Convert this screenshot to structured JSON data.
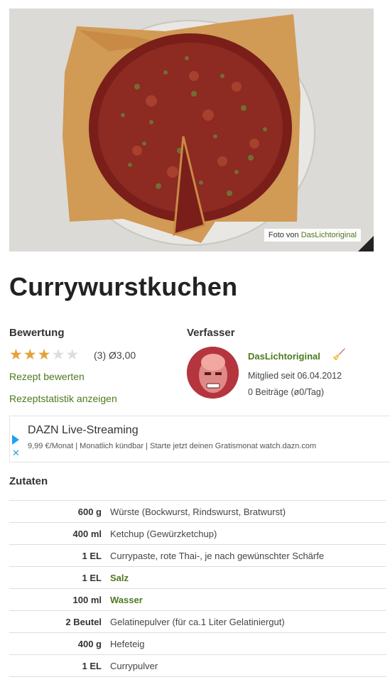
{
  "photo": {
    "credit_prefix": "Foto von",
    "credit_author": "DasLichtoriginal"
  },
  "recipe": {
    "title": "Currywurstkuchen"
  },
  "rating": {
    "heading": "Bewertung",
    "stars_filled": 3,
    "stars_total": 5,
    "summary": "(3)  Ø3,00",
    "rate_link": "Rezept bewerten",
    "stats_link": "Rezeptstatistik anzeigen"
  },
  "author": {
    "heading": "Verfasser",
    "name": "DasLichtoriginal",
    "member_since": "Mitglied seit 06.04.2012",
    "posts": "0 Beiträge (ø0/Tag)"
  },
  "ad": {
    "title": "DAZN Live-Streaming",
    "text": "9,99 €/Monat | Monatlich kündbar | Starte jetzt deinen Gratismonat watch.dazn.com"
  },
  "ingredients": {
    "heading": "Zutaten",
    "rows": [
      {
        "amount": "600 g",
        "name": "Würste (Bockwurst, Rindswurst, Bratwurst)",
        "linked": false
      },
      {
        "amount": "400 ml",
        "name": "Ketchup (Gewürzketchup)",
        "linked": false
      },
      {
        "amount": "1 EL",
        "name": "Currypaste, rote Thai-, je nach gewünschter Schärfe",
        "linked": false
      },
      {
        "amount": "1 EL",
        "name": "Salz",
        "linked": true
      },
      {
        "amount": "100 ml",
        "name": "Wasser",
        "linked": true
      },
      {
        "amount": "2 Beutel",
        "name": "Gelatinepulver (für ca.1 Liter Gelatiniergut)",
        "linked": false
      },
      {
        "amount": "400 g",
        "name": "Hefeteig",
        "linked": false
      },
      {
        "amount": "1 EL",
        "name": "Currypulver",
        "linked": false
      }
    ]
  },
  "colors": {
    "accent_green": "#4d7a1f",
    "star_on": "#e5a13a",
    "star_off": "#dddddd",
    "ad_blue": "#1da1f2"
  }
}
